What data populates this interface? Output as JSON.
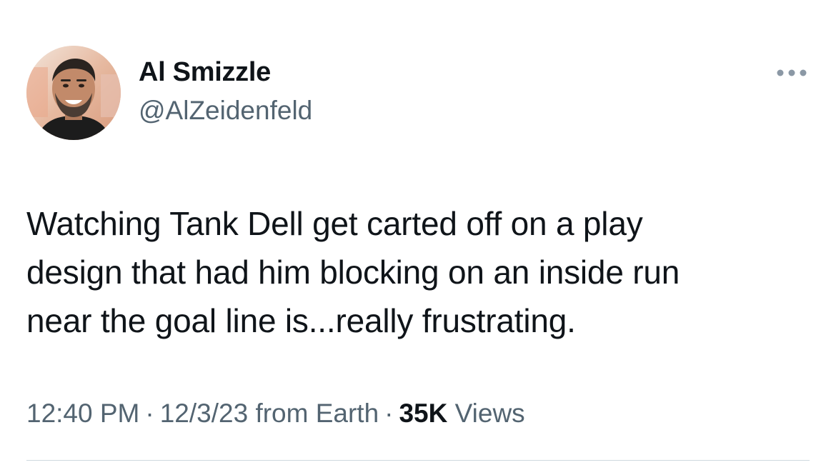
{
  "author": {
    "display_name": "Al Smizzle",
    "handle": "@AlZeidenfeld",
    "avatar_icon": "profile-photo"
  },
  "menu": {
    "icon": "more-horizontal-icon"
  },
  "tweet": {
    "text": "Watching Tank Dell get carted off on a play\ndesign that had him blocking on an inside run\nnear the goal line is...really frustrating."
  },
  "meta": {
    "time": "12:40 PM",
    "separator": "·",
    "date": "12/3/23",
    "source": "from Earth",
    "views_count": "35K",
    "views_label": "Views"
  },
  "colors": {
    "text": "#0f1419",
    "secondary": "#536471",
    "divider": "#cfd9de"
  }
}
